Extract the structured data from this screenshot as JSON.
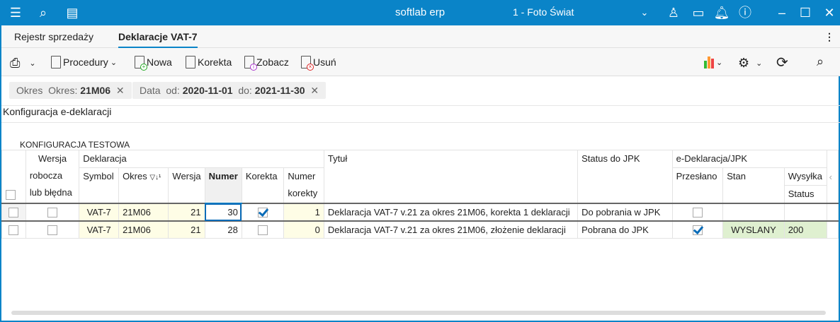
{
  "titlebar": {
    "app": "softlab erp",
    "company": "1 - Foto Świat"
  },
  "tabs": [
    {
      "label": "Rejestr sprzedaży"
    },
    {
      "label": "Deklaracje VAT-7"
    }
  ],
  "toolbar": {
    "procedury": "Procedury",
    "nowa": "Nowa",
    "korekta": "Korekta",
    "zobacz": "Zobacz",
    "usun": "Usuń"
  },
  "filters": [
    {
      "label": "Okres",
      "k1": "Okres:",
      "v1": "21M06"
    },
    {
      "label": "Data",
      "k1": "od:",
      "v1": "2020-11-01",
      "k2": "do:",
      "v2": "2021-11-30"
    }
  ],
  "section_title": "Konfiguracja e-deklaracji",
  "config_name": "KONFIGURACJA TESTOWA",
  "grid": {
    "headers": {
      "wersja1": "Wersja",
      "wersja2": "robocza",
      "wersja3": "lub błędna",
      "deklaracja": "Deklaracja",
      "symbol": "Symbol",
      "okres": "Okres",
      "wersja": "Wersja",
      "numer": "Numer",
      "korekta": "Korekta",
      "numer_korekty1": "Numer",
      "numer_korekty2": "korekty",
      "tytul": "Tytuł",
      "status_jpk": "Status do JPK",
      "edekl": "e-Deklaracja/JPK",
      "przeslano": "Przesłano",
      "stan": "Stan",
      "wysylka": "Wysyłka",
      "status": "Status"
    },
    "rows": [
      {
        "robocza": false,
        "symbol": "VAT-7",
        "okres": "21M06",
        "wersja": "21",
        "numer": "30",
        "korekta": true,
        "numer_korekty": "1",
        "tytul": "Deklaracja VAT-7 v.21 za okres 21M06, korekta 1 deklaracji",
        "status_jpk": "Do pobrania w JPK",
        "przeslano": false,
        "stan": "",
        "status": ""
      },
      {
        "robocza": false,
        "symbol": "VAT-7",
        "okres": "21M06",
        "wersja": "21",
        "numer": "28",
        "korekta": false,
        "numer_korekty": "0",
        "tytul": "Deklaracja VAT-7 v.21 za okres 21M06, złożenie deklaracji",
        "status_jpk": "Pobrana do JPK",
        "przeslano": true,
        "stan": "WYSLANY",
        "status": "200"
      }
    ]
  }
}
